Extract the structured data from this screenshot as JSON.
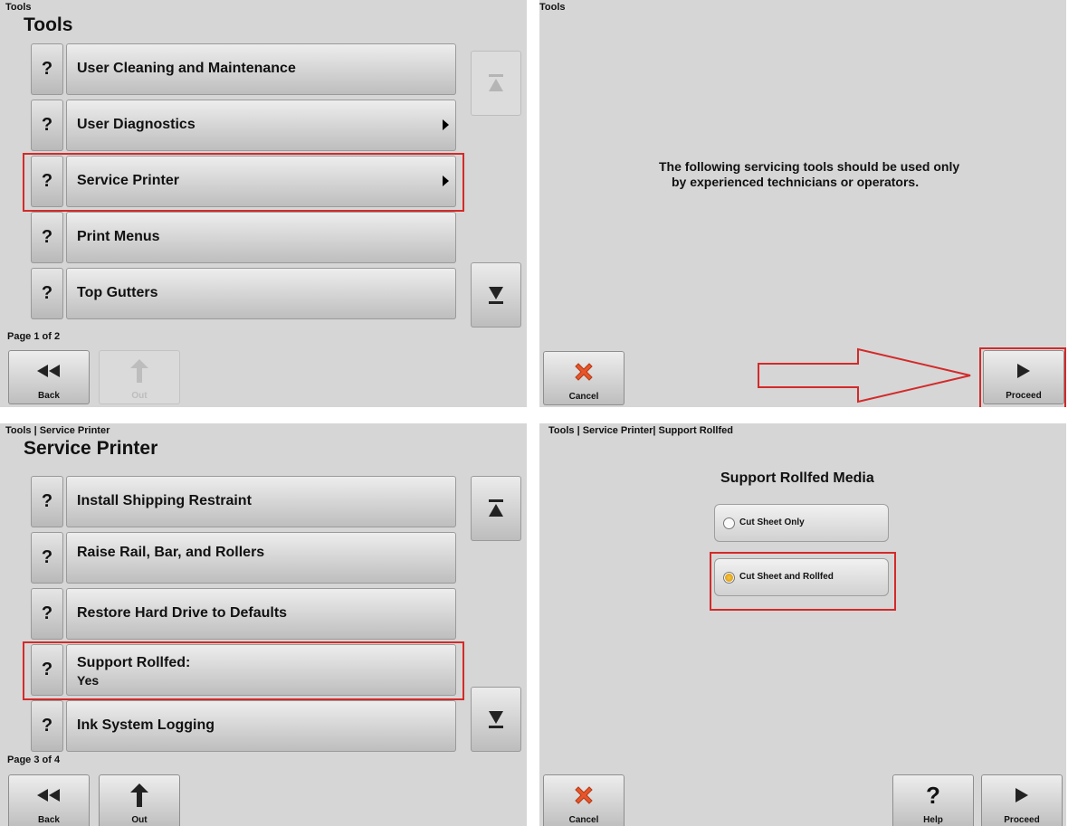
{
  "panel_tl": {
    "breadcrumb": "Tools",
    "title": "Tools",
    "items": [
      {
        "label": "User Cleaning and Maintenance",
        "help": "?"
      },
      {
        "label": "User Diagnostics",
        "help": "?"
      },
      {
        "label": "Service Printer",
        "help": "?"
      },
      {
        "label": "Print Menus",
        "help": "?"
      },
      {
        "label": "Top Gutters",
        "help": "?"
      }
    ],
    "page": "Page 1 of 2",
    "back_label": "Back",
    "out_label": "Out"
  },
  "panel_tr": {
    "breadcrumb": "Tools",
    "message_line1": "The following servicing tools should be used only",
    "message_line2": "by experienced technicians or operators.",
    "cancel_label": "Cancel",
    "proceed_label": "Proceed"
  },
  "panel_bl": {
    "breadcrumb": "Tools | Service Printer",
    "title": "Service Printer",
    "items": [
      {
        "label": "Install Shipping Restraint",
        "help": "?"
      },
      {
        "label": "Raise Rail, Bar, and Rollers",
        "help": "?"
      },
      {
        "label": "Restore Hard Drive to Defaults",
        "help": "?"
      },
      {
        "label": "Support Rollfed:",
        "value": "Yes",
        "help": "?"
      },
      {
        "label": "Ink System Logging",
        "help": "?"
      }
    ],
    "page": "Page 3 of 4",
    "back_label": "Back",
    "out_label": "Out"
  },
  "panel_br": {
    "breadcrumb": "Tools | Service Printer| Support Rollfed",
    "title": "Support Rollfed Media",
    "options": [
      {
        "label": "Cut Sheet Only",
        "selected": false
      },
      {
        "label": "Cut Sheet and Rollfed",
        "selected": true
      }
    ],
    "cancel_label": "Cancel",
    "help_label": "Help",
    "help_glyph": "?",
    "proceed_label": "Proceed"
  },
  "colors": {
    "highlight": "#d32a2a",
    "panel_bg": "#d6d6d6",
    "radio_selected": "#e2a21c",
    "cancel_x": "#e8552a"
  }
}
